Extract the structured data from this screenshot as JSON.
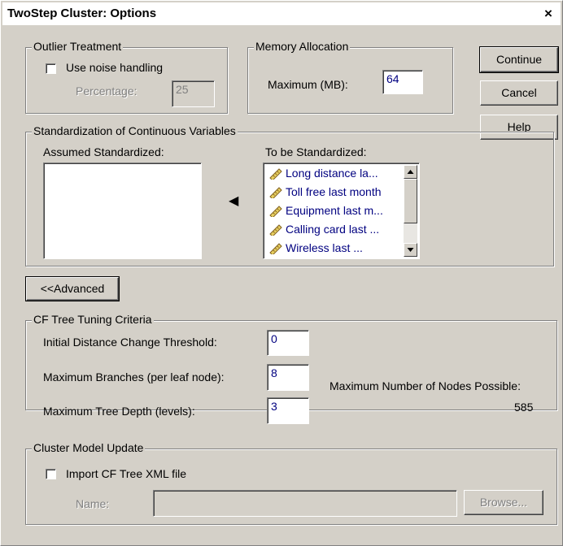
{
  "dialog": {
    "title": "TwoStep Cluster: Options",
    "close_glyph": "×"
  },
  "outlier": {
    "legend": "Outlier Treatment",
    "use_noise_label": "Use noise handling",
    "use_noise_checked": false,
    "percentage_label": "Percentage:",
    "percentage_value": "25"
  },
  "memory": {
    "legend": "Memory Allocation",
    "maximum_label": "Maximum (MB):",
    "maximum_value": "64"
  },
  "buttons": {
    "continue": "Continue",
    "cancel": "Cancel",
    "help": "Help"
  },
  "standardization": {
    "legend": "Standardization of Continuous Variables",
    "assumed_label": "Assumed Standardized:",
    "assumed_items": [],
    "to_be_label": "To be Standardized:",
    "to_be_items": [
      "Long distance la...",
      "Toll free last month",
      "Equipment last m...",
      "Calling card last ...",
      "Wireless last ..."
    ],
    "move_arrow": "◀"
  },
  "advanced_button": "<<Advanced",
  "cf_tree": {
    "legend": "CF Tree Tuning Criteria",
    "initial_distance_label": "Initial Distance Change Threshold:",
    "initial_distance_value": "0",
    "max_branches_label": "Maximum Branches (per leaf node):",
    "max_branches_value": "8",
    "max_depth_label": "Maximum Tree Depth (levels):",
    "max_depth_value": "3",
    "max_nodes_label": "Maximum Number of Nodes Possible:",
    "max_nodes_value": "585"
  },
  "model_update": {
    "legend": "Cluster Model Update",
    "import_label": "Import CF Tree XML file",
    "import_checked": false,
    "name_label": "Name:",
    "name_value": "",
    "browse_label": "Browse..."
  }
}
